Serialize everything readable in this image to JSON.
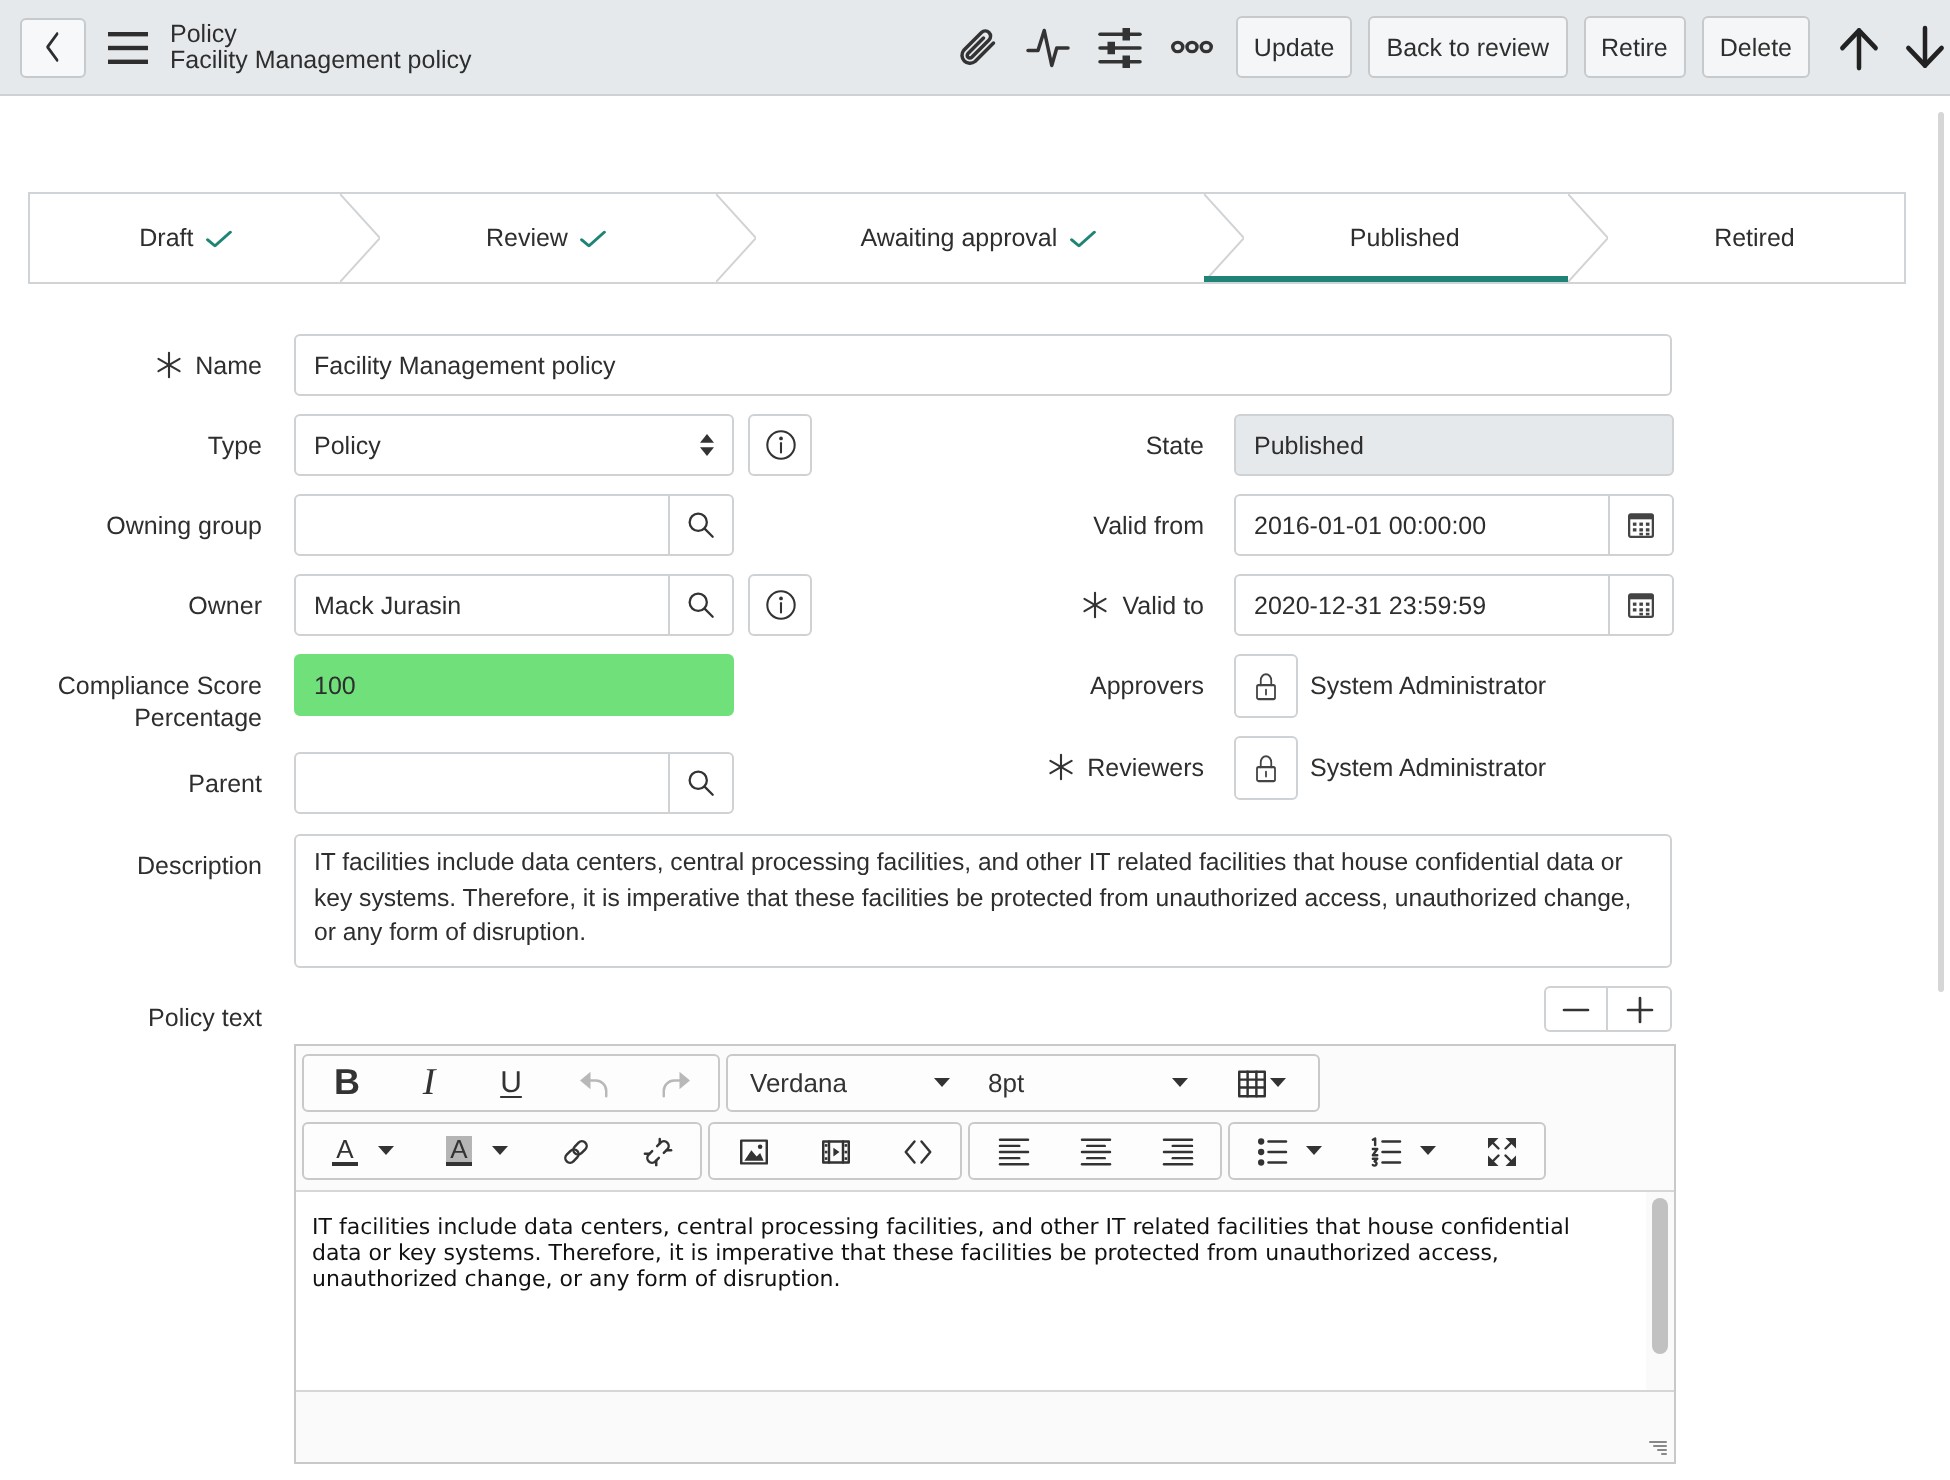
{
  "header": {
    "title": "Policy",
    "subtitle": "Facility Management policy",
    "buttons": [
      "Update",
      "Back to review",
      "Retire",
      "Delete"
    ]
  },
  "stages": [
    {
      "label": "Draft",
      "done": true,
      "selected": false
    },
    {
      "label": "Review",
      "done": true,
      "selected": false
    },
    {
      "label": "Awaiting approval",
      "done": true,
      "selected": false
    },
    {
      "label": "Published",
      "done": false,
      "selected": true
    },
    {
      "label": "Retired",
      "done": false,
      "selected": false
    }
  ],
  "name_field": {
    "label": "Name",
    "required": true,
    "value": "Facility Management policy"
  },
  "left_fields": [
    {
      "label": "Type",
      "kind": "select",
      "required": false,
      "info": true,
      "value": "Policy"
    },
    {
      "label": "Owning group",
      "kind": "reference",
      "required": false,
      "info": false
    },
    {
      "label": "Owner",
      "kind": "reference",
      "required": false,
      "info": true,
      "value": "Mack Jurasin"
    },
    {
      "label": "Compliance Score Percentage",
      "kind": "text",
      "required": false,
      "info": false,
      "value": "100",
      "color": "#6fe07a"
    },
    {
      "label": "Parent",
      "kind": "reference",
      "required": false,
      "info": false
    }
  ],
  "right_fields": [
    {
      "label": "State",
      "kind": "readonly",
      "required": false,
      "value": "Published"
    },
    {
      "label": "Valid from",
      "kind": "date",
      "required": false,
      "value": "2016-01-01 00:00:00"
    },
    {
      "label": "Valid to",
      "kind": "date",
      "required": true,
      "value": "2020-12-31 23:59:59"
    },
    {
      "label": "Approvers",
      "kind": "locked",
      "required": false,
      "value": "System Administrator"
    },
    {
      "label": "Reviewers",
      "kind": "locked",
      "required": true,
      "value": "System Administrator"
    }
  ],
  "description": {
    "label": "Description",
    "required": false,
    "value": "IT facilities include data centers, central processing facilities, and other IT related facilities that house confidential data or key systems. Therefore, it is imperative that these facilities be protected from unauthorized access, unauthorized change, or any form of disruption."
  },
  "policy_text": {
    "label": "Policy text",
    "required": false,
    "editor": {
      "bold": "B",
      "italic": "I",
      "underline": "U",
      "undo": {
        "disabled": true
      },
      "redo": {
        "disabled": true
      },
      "font": "Verdana",
      "size": "8pt",
      "text_color": "A",
      "background_color": "A",
      "content": "IT facilities include data centers, central processing facilities, and other IT related facilities that house confidential data or key systems. Therefore, it is imperative that these facilities be protected from unauthorized access, unauthorized change, or any form of disruption."
    }
  }
}
